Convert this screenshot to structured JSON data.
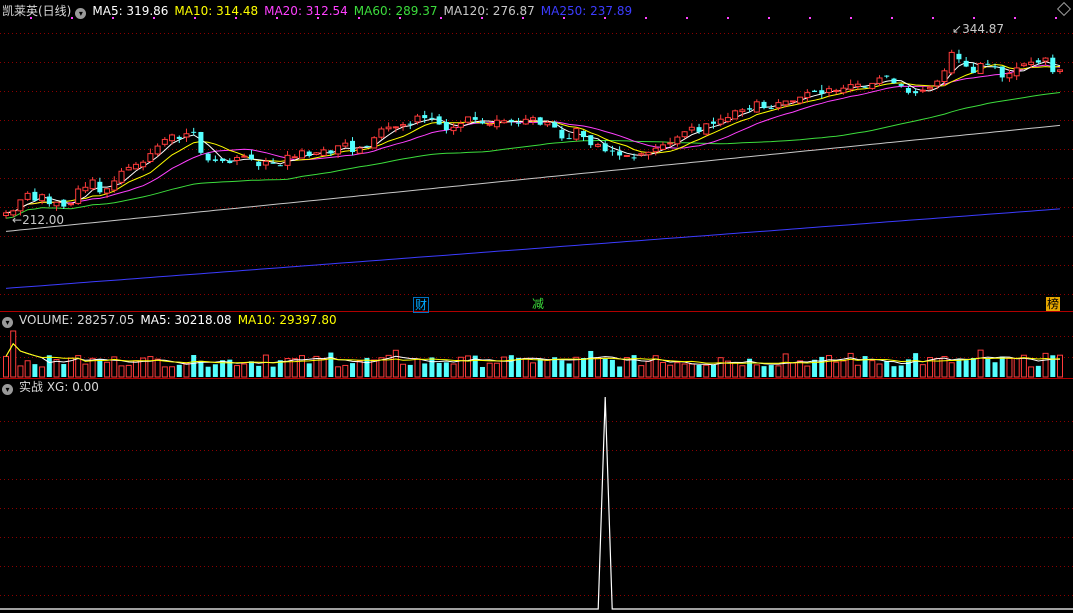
{
  "header": {
    "stock": "凯莱英(日线)",
    "ma5": "MA5: 319.86",
    "ma10": "MA10: 314.48",
    "ma20": "MA20: 312.54",
    "ma60": "MA60: 289.37",
    "ma120": "MA120: 276.87",
    "ma250": "MA250: 237.89"
  },
  "price_labels": {
    "high": "344.87",
    "low": "212.00"
  },
  "events": {
    "cai": "财",
    "jian": "减",
    "bang": "榜"
  },
  "volume_header": {
    "volume": "VOLUME: 28257.05",
    "ma5": "MA5: 30218.08",
    "ma10": "MA10: 29397.80"
  },
  "indicator_header": {
    "label": "实战 XG: 0.00"
  },
  "colors": {
    "up": "#ff3b3b",
    "down": "#54ffff",
    "ma5": "#ffffff",
    "ma10": "#ffff00",
    "ma20": "#ff40ff",
    "ma60": "#3cdc3c",
    "ma120": "#c8c8c8",
    "ma250": "#3c3cff",
    "grid": "#8b0000"
  },
  "chart_data": {
    "type": "candlestick",
    "ohlc_close": [
      212,
      213.5,
      221.8,
      226.7,
      221.2,
      225.7,
      218.6,
      220,
      216.7,
      218.9,
      230,
      231.3,
      236.8,
      227.5,
      230.2,
      236.1,
      243.4,
      246.3,
      248.6,
      250.2,
      256.7,
      262.4,
      267.4,
      270.8,
      267.8,
      271.7,
      272.8,
      257.3,
      251.6,
      251.2,
      251.1,
      249.6,
      253.8,
      254.8,
      252.5,
      247.3,
      250.9,
      249.8,
      247.7,
      255.4,
      254.3,
      258.8,
      254.9,
      257.3,
      259.5,
      256.8,
      262.6,
      264.6,
      257.9,
      261,
      262.2,
      268.7,
      275.3,
      276.7,
      276.9,
      278.6,
      279.1,
      285,
      283.5,
      283.5,
      278.7,
      274.5,
      276.6,
      279.5,
      284.4,
      282.2,
      279.5,
      278.9,
      281.9,
      281.5,
      280.8,
      279.5,
      282.6,
      283.8,
      278.5,
      280.3,
      276.4,
      268.2,
      268,
      275.6,
      269.2,
      263.1,
      263.5,
      258.5,
      258.9,
      255.3,
      255.3,
      253.8,
      256.6,
      257.7,
      260.8,
      263.3,
      264.8,
      269.2,
      273.2,
      276.6,
      273.1,
      279.2,
      279.2,
      282.7,
      283.9,
      289,
      289.7,
      289.9,
      295.8,
      291.1,
      291,
      295.2,
      296.4,
      296.5,
      299.3,
      302.7,
      303.2,
      301.9,
      305.7,
      304.4,
      306.1,
      308.8,
      309.1,
      306.6,
      309.7,
      313.8,
      315,
      309.9,
      307.8,
      302.6,
      302.3,
      304.6,
      306.7,
      311.4,
      319.2,
      333.1,
      327.9,
      322.4,
      317.6,
      324.7,
      324.5,
      322.3,
      314.2,
      317.1,
      321.4,
      324.4,
      325.7,
      325.4,
      328.8,
      318.2,
      319.9
    ]
  }
}
